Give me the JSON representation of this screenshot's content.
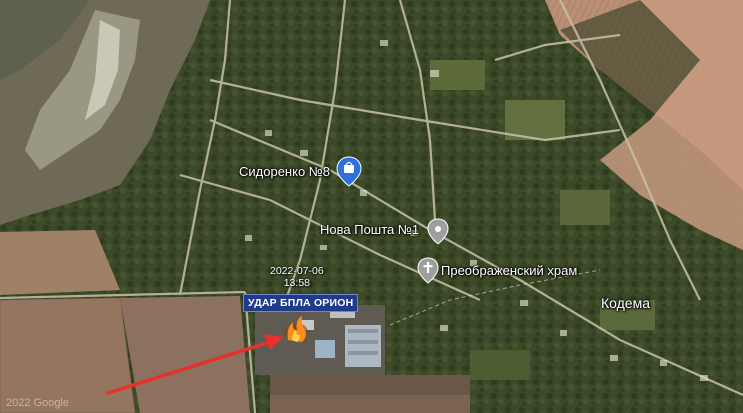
{
  "map": {
    "places": {
      "sidorenko": "Сидоренко №8",
      "nova_poshta": "Нова Пошта №1",
      "church": "Преображенский храм",
      "village": "Кодема"
    },
    "event": {
      "date": "2022-07-06",
      "time": "13:58",
      "banner": "УДАР БПЛА ОРИОН"
    },
    "watermark": "2022 Google",
    "colors": {
      "banner_bg": "#1f3b8a",
      "arrow": "#e8312a",
      "fire": "#ff8c1a",
      "shop_marker": "#2f6fde",
      "gray_marker": "#9e9e9e"
    },
    "icons": [
      "shopping-bag-icon",
      "location-pin-icon",
      "church-pin-icon",
      "fire-icon",
      "arrow-icon"
    ]
  }
}
